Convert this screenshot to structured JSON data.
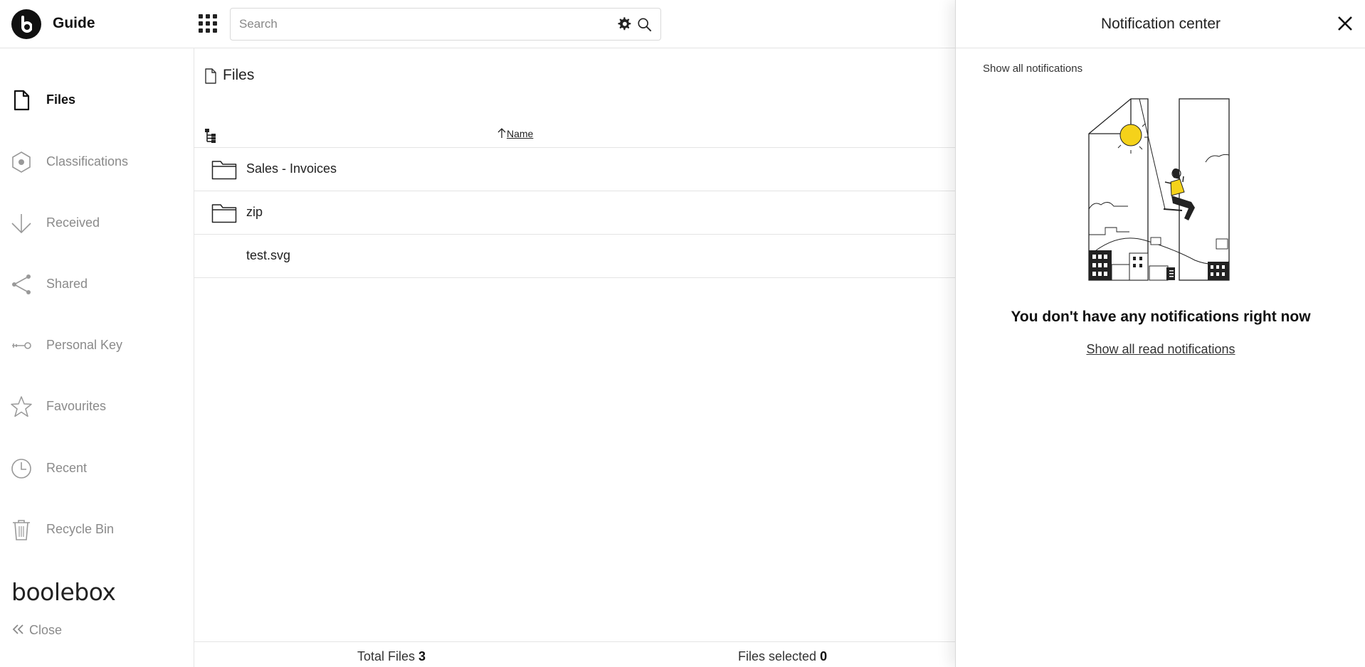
{
  "app": {
    "name": "Guide"
  },
  "search": {
    "placeholder": "Search"
  },
  "sidebar": {
    "items": [
      {
        "label": "Files",
        "icon": "file-icon",
        "active": true
      },
      {
        "label": "Classifications",
        "icon": "hexagon-icon",
        "active": false
      },
      {
        "label": "Received",
        "icon": "arrow-down-icon",
        "active": false
      },
      {
        "label": "Shared",
        "icon": "share-icon",
        "active": false
      },
      {
        "label": "Personal Key",
        "icon": "key-icon",
        "active": false
      },
      {
        "label": "Favourites",
        "icon": "star-icon",
        "active": false
      },
      {
        "label": "Recent",
        "icon": "clock-icon",
        "active": false
      },
      {
        "label": "Recycle Bin",
        "icon": "trash-icon",
        "active": false
      }
    ],
    "brand": "boolebox",
    "close_label": "Close"
  },
  "main": {
    "breadcrumb": "Files",
    "columns": {
      "name": "Name"
    },
    "rows": [
      {
        "name": "Sales - Invoices",
        "type": "folder"
      },
      {
        "name": "zip",
        "type": "folder"
      },
      {
        "name": "test.svg",
        "type": "file"
      }
    ],
    "footer": {
      "total_label": "Total Files",
      "total_value": "3",
      "selected_label": "Files selected",
      "selected_value": "0"
    }
  },
  "notifications": {
    "title": "Notification center",
    "show_all": "Show all notifications",
    "empty_message": "You don't have any notifications right now",
    "read_link": "Show all read notifications"
  },
  "colors": {
    "accent": "#f5d21a",
    "text": "#222222",
    "muted": "#8a8a8a",
    "border": "#e4e4e4"
  }
}
